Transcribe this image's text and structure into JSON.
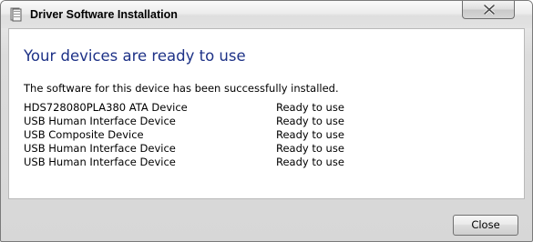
{
  "window": {
    "title": "Driver Software Installation"
  },
  "titlebar": {
    "icon": "driver-install-icon",
    "close_icon": "close-icon"
  },
  "main": {
    "heading": "Your devices are ready to use",
    "message": "The software for this device has been successfully installed.",
    "devices": [
      {
        "name": "HDS728080PLA380 ATA Device",
        "status": "Ready to use"
      },
      {
        "name": "USB Human Interface Device",
        "status": "Ready to use"
      },
      {
        "name": "USB Composite Device",
        "status": "Ready to use"
      },
      {
        "name": "USB Human Interface Device",
        "status": "Ready to use"
      },
      {
        "name": "USB Human Interface Device",
        "status": "Ready to use"
      }
    ]
  },
  "footer": {
    "close_label": "Close"
  },
  "colors": {
    "heading": "#1e3287",
    "window_frame": "#d7d7d7"
  }
}
